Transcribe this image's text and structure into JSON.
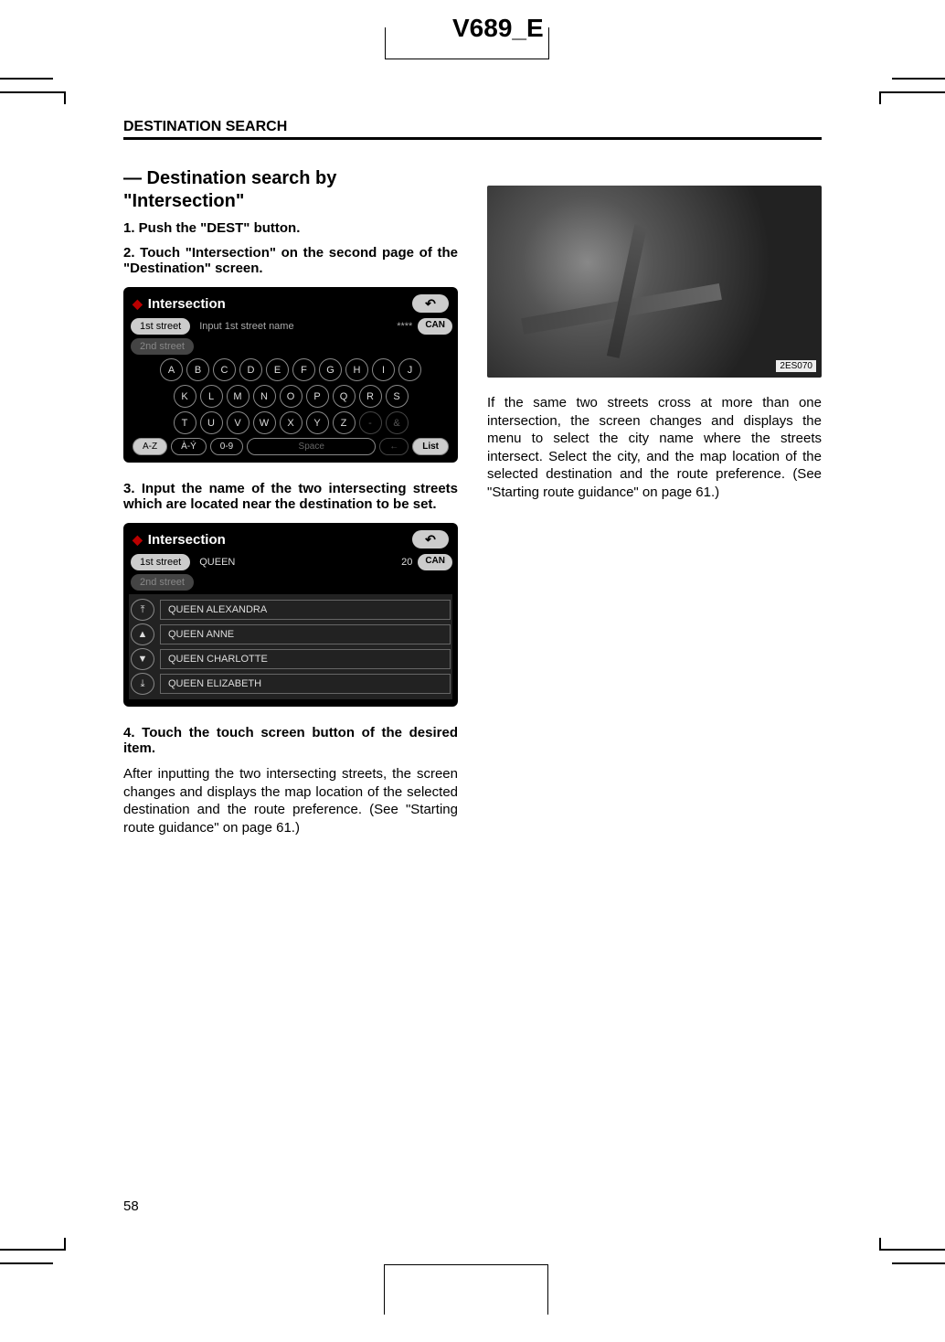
{
  "header": {
    "doc_code": "V689_E"
  },
  "section_header": "DESTINATION SEARCH",
  "page_number": "58",
  "left": {
    "title_line1": "— Destination search by",
    "title_line2": "\"Intersection\"",
    "step1": "1.   Push the \"DEST\" button.",
    "step2": "2.   Touch \"Intersection\" on the second page of the \"Destination\" screen.",
    "screenshot1": {
      "title": "Intersection",
      "tab_1st": "1st street",
      "tab_1st_hint": "Input 1st street name",
      "tab_dots": "****",
      "can": "CAN",
      "tab_2nd": "2nd street",
      "keys_row1": [
        "A",
        "B",
        "C",
        "D",
        "E",
        "F",
        "G",
        "H",
        "I",
        "J"
      ],
      "keys_row2": [
        "K",
        "L",
        "M",
        "N",
        "O",
        "P",
        "Q",
        "R",
        "S"
      ],
      "keys_row3": [
        "T",
        "U",
        "V",
        "W",
        "X",
        "Y",
        "Z",
        "-",
        "&"
      ],
      "bottom": {
        "az": "A-Z",
        "ay": "À-Ý",
        "num": "0-9",
        "space": "Space",
        "back": "←",
        "list": "List"
      }
    },
    "step3": "3.   Input the name of the two intersecting streets which are located near the destination to be set.",
    "screenshot2": {
      "title": "Intersection",
      "tab_1st": "1st street",
      "input_value": "QUEEN",
      "count": "20",
      "can": "CAN",
      "tab_2nd": "2nd street",
      "items": [
        "QUEEN ALEXANDRA",
        "QUEEN ANNE",
        "QUEEN CHARLOTTE",
        "QUEEN ELIZABETH"
      ]
    },
    "step4": "4.   Touch the touch screen button of the desired item.",
    "body": "After inputting the two intersecting streets, the screen changes and displays the map location of the selected destination and the route preference.  (See \"Starting route guidance\" on page 61.)"
  },
  "right": {
    "ref_label": "2ES070",
    "body": "If the same two streets cross at more than one intersection, the screen changes and displays the menu to select the city name where the streets intersect. Select the city, and the map location of the selected destination and the route preference.  (See \"Starting route guidance\" on page 61.)"
  }
}
